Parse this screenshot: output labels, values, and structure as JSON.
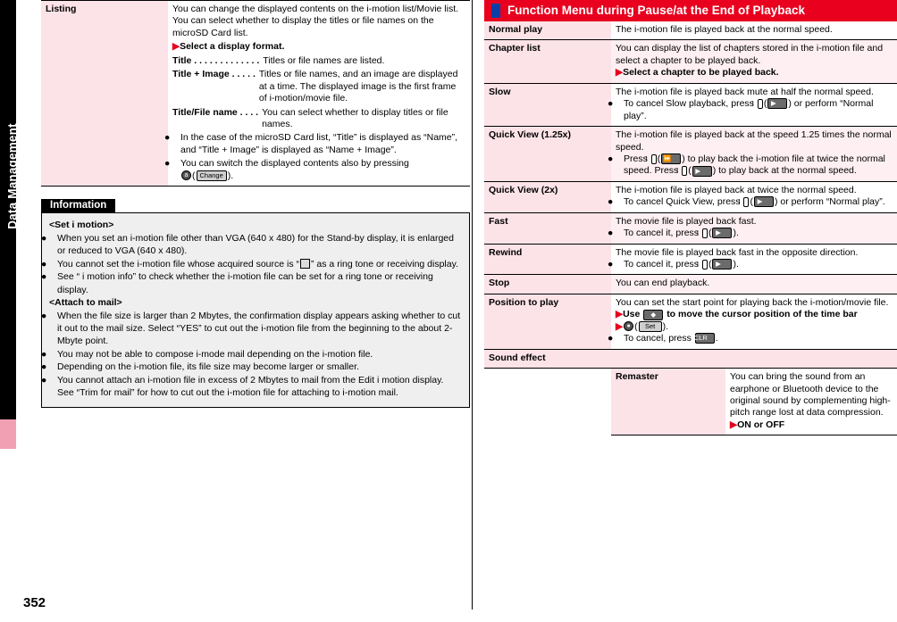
{
  "sidebar": {
    "label": "Data Management",
    "page_number": "352"
  },
  "left": {
    "listing": {
      "label": "Listing",
      "p1": "You can change the displayed contents on the i-motion list/Movie list. You can select whether to display the titles or file names on the microSD Card list.",
      "arrow1": "Select a display format.",
      "items": [
        {
          "term": "Title . . . . . . . . . . . . .",
          "desc": "Titles or file names are listed."
        },
        {
          "term": "Title + Image  . . . . .",
          "desc": "Titles or file names, and an image are displayed at a time. The displayed image is the first frame of i-motion/movie file."
        },
        {
          "term": "Title/File name . . . .",
          "desc": "You can select whether to display titles or file names."
        }
      ],
      "b1": "In the case of the microSD Card list, “Title” is displayed as “Name”, and “Title + Image” is displayed as “Name + Image”.",
      "b2_pre": "You can switch the displayed contents also by pressing",
      "b2_key": "a",
      "b2_btn": "Change",
      "b2_post": ")."
    },
    "information": {
      "heading": "Information",
      "sub1": "<Set i motion>",
      "i1": "When you set an i-motion file other than VGA (640 x 480) for the Stand-by display, it is enlarged or reduced to VGA (640 x 480).",
      "i2": "You cannot set the i-motion file whose acquired source is “   ” as a ring tone or receiving display.",
      "i3": "See “ i motion info” to check whether the i-motion file can be set for a ring tone or receiving display.",
      "sub2": "<Attach to mail>",
      "i4": "When the file size is larger than 2 Mbytes, the confirmation display appears asking whether to cut it out to the mail size. Select “YES” to cut out the i-motion file from the beginning to the about 2-Mbyte point.",
      "i5": "You may not be able to compose i-mode mail depending on the i-motion file.",
      "i6": "Depending on the i-motion file, its file size may become larger or smaller.",
      "i7": "You cannot attach an i-motion file in excess of 2 Mbytes to mail from the Edit i motion display. See “Trim for mail” for how to cut out the i-motion file for attaching to i-motion mail."
    }
  },
  "right": {
    "header": "Function Menu during Pause/at the End of Playback",
    "rows": [
      {
        "label": "Normal play",
        "lines": [
          {
            "type": "text",
            "text": "The i-motion file is played back at the normal speed."
          }
        ]
      },
      {
        "label": "Chapter list",
        "lines": [
          {
            "type": "text",
            "text": "You can display the list of chapters stored in the i-motion file and select a chapter to be played back."
          },
          {
            "type": "arrow",
            "text": "Select a chapter to be played back."
          }
        ]
      },
      {
        "label": "Slow",
        "lines": [
          {
            "type": "text",
            "text": "The i-motion file is played back mute at half the normal speed."
          },
          {
            "type": "bullet-keys",
            "pre": "To cancel Slow playback, press",
            "key": "l",
            "btn": "play",
            "post": ") or perform “Normal play”."
          }
        ]
      },
      {
        "label": "Quick View (1.25x)",
        "lines": [
          {
            "type": "text",
            "text": "The i-motion file is played back at the speed 1.25 times the normal speed."
          },
          {
            "type": "bullet-keys2",
            "pre": "Press",
            "key": "l",
            "btn": "quick",
            "mid": ") to play back the i-motion file at twice the normal speed. Press",
            "key2": "l",
            "btn2": "play",
            "post": ") to play back at the normal speed."
          }
        ]
      },
      {
        "label": "Quick View (2x)",
        "lines": [
          {
            "type": "text",
            "text": "The i-motion file is played back at twice the normal speed."
          },
          {
            "type": "bullet-keys",
            "pre": "To cancel Quick View, press",
            "key": "l",
            "btn": "play",
            "post": ") or perform “Normal play”."
          }
        ]
      },
      {
        "label": "Fast",
        "lines": [
          {
            "type": "text",
            "text": "The movie file is played back fast."
          },
          {
            "type": "bullet-keys",
            "pre": "To cancel it, press",
            "key": "l",
            "btn": "",
            "post": ")."
          }
        ]
      },
      {
        "label": "Rewind",
        "lines": [
          {
            "type": "text",
            "text": "The movie file is played back fast in the opposite direction."
          },
          {
            "type": "bullet-keys",
            "pre": "To cancel it, press",
            "key": "l",
            "btn": "play",
            "post": ")."
          }
        ]
      },
      {
        "label": "Stop",
        "lines": [
          {
            "type": "text",
            "text": "You can end playback."
          }
        ]
      },
      {
        "label": "Position to play",
        "lines": [
          {
            "type": "text",
            "text": "You can set the start point for playing back the i-motion/movie file."
          },
          {
            "type": "arrow-use",
            "pre": "Use",
            "post": "to move the cursor position of the time bar"
          },
          {
            "type": "arrow-set",
            "btn": "Set",
            "post": ")."
          },
          {
            "type": "bullet-clr",
            "pre": "To cancel, press",
            "key": "CLR",
            "post": "."
          }
        ]
      }
    ],
    "sound_effect": {
      "label": "Sound effect",
      "sub": {
        "label": "Remaster",
        "lines": [
          {
            "type": "text",
            "text": "You can bring the sound from an earphone or Bluetooth device to the original sound by complementing high-pitch range lost at data compression."
          },
          {
            "type": "arrow",
            "text": "ON or OFF"
          }
        ]
      }
    }
  }
}
